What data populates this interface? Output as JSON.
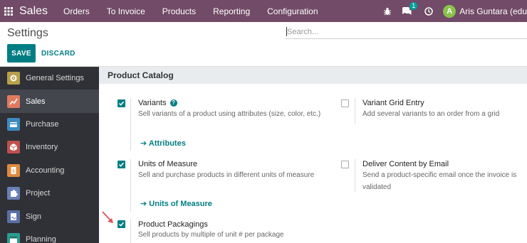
{
  "navbar": {
    "brand": "Sales",
    "menu": [
      "Orders",
      "To Invoice",
      "Products",
      "Reporting",
      "Configuration"
    ],
    "messages_count": "1",
    "user_initial": "A",
    "user_name": "Aris Guntara (edu"
  },
  "control_panel": {
    "title": "Settings",
    "search_placeholder": "Search...",
    "save_label": "SAVE",
    "discard_label": "DISCARD"
  },
  "sidebar": {
    "items": [
      {
        "label": "General Settings",
        "icon": "gear-app-icon",
        "color": "#b8a04a"
      },
      {
        "label": "Sales",
        "icon": "sales-chart-icon",
        "color": "#e07a5f"
      },
      {
        "label": "Purchase",
        "icon": "purchase-card-icon",
        "color": "#3d8bbf"
      },
      {
        "label": "Inventory",
        "icon": "inventory-box-icon",
        "color": "#c0504d"
      },
      {
        "label": "Accounting",
        "icon": "accounting-doc-icon",
        "color": "#e0893e"
      },
      {
        "label": "Project",
        "icon": "project-puzzle-icon",
        "color": "#6a7fb5"
      },
      {
        "label": "Sign",
        "icon": "sign-pen-icon",
        "color": "#5b6fa6"
      },
      {
        "label": "Planning",
        "icon": "planning-calendar-icon",
        "color": "#2a9d8f"
      }
    ],
    "active_index": 1
  },
  "section": {
    "title": "Product Catalog",
    "settings": {
      "variants": {
        "title": "Variants",
        "desc": "Sell variants of a product using attributes (size, color, etc.)",
        "link": "Attributes",
        "checked": true
      },
      "variant_grid": {
        "title": "Variant Grid Entry",
        "desc": "Add several variants to an order from a grid",
        "checked": false
      },
      "uom": {
        "title": "Units of Measure",
        "desc": "Sell and purchase products in different units of measure",
        "link": "Units of Measure",
        "checked": true
      },
      "deliver_content": {
        "title": "Deliver Content by Email",
        "desc": "Send a product-specific email once the invoice is validated",
        "checked": false
      },
      "packagings": {
        "title": "Product Packagings",
        "desc": "Sell products by multiple of unit # per package",
        "checked": true
      }
    }
  },
  "colors": {
    "navbar": "#714b67",
    "accent": "#017e84",
    "sidebar": "#2f3136",
    "annotation_arrow": "#e0525a"
  }
}
